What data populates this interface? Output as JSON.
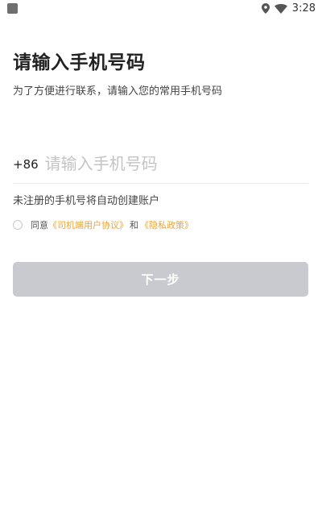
{
  "status_bar": {
    "time": "3:28",
    "icons": [
      "app-notification-icon",
      "location-icon",
      "wifi-icon"
    ]
  },
  "login": {
    "title": "请输入手机号码",
    "subtitle": "为了方便进行联系，请输入您的常用手机号码",
    "country_code": "+86",
    "phone_placeholder": "请输入手机号码",
    "phone_value": "",
    "hint": "未注册的手机号将自动创建账户",
    "agreement": {
      "checked": false,
      "prefix": "同意",
      "user_agreement": "《司机端用户协议》",
      "and": "和",
      "privacy_policy": "《隐私政策》"
    },
    "next_button": "下一步"
  },
  "colors": {
    "link": "#e8a33c",
    "button_disabled": "#c9cacf",
    "placeholder": "#c4c4c4"
  }
}
